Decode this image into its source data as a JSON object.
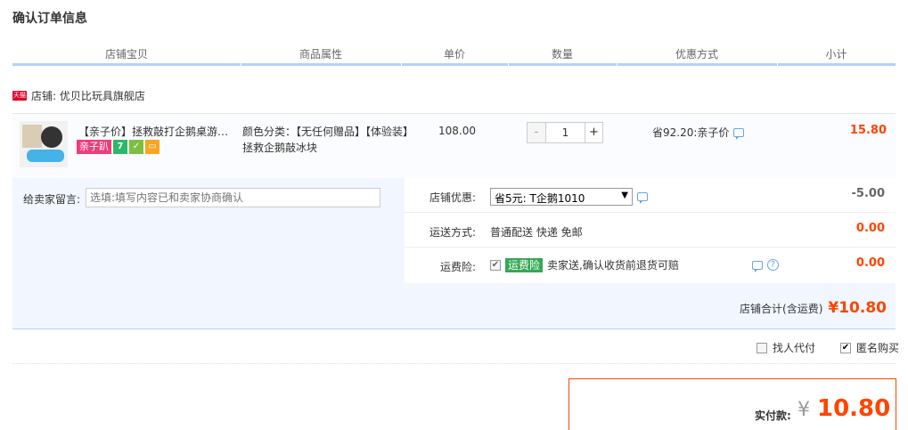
{
  "page_title": "确认订单信息",
  "columns": [
    "店铺宝贝",
    "商品属性",
    "单价",
    "数量",
    "优惠方式",
    "小计"
  ],
  "shop": {
    "badge": "天猫",
    "label": "店铺: 优贝比玩具旗舰店"
  },
  "item": {
    "title": "【亲子价】拯救敲打企鹅桌游冰块破冰游戏",
    "tags": {
      "qinzi": "亲子趴",
      "seven": "7"
    },
    "attr": "颜色分类：【无任何赠品】【体验装】拯救企鹅敲冰块",
    "unit_price": "108.00",
    "quantity": "1",
    "minus": "-",
    "plus": "+",
    "discount": "省92.20:亲子价",
    "subtotal": "15.80"
  },
  "detail": {
    "memo_label": "给卖家留言:",
    "memo_placeholder": "选填:填写内容已和卖家协商确认",
    "shop_discount_label": "店铺优惠:",
    "shop_discount_select": "省5元: T企鹅1010",
    "shop_discount_value": "-5.00",
    "shipping_label": "运送方式:",
    "shipping_method": "普通配送 快递 免邮",
    "shipping_value": "0.00",
    "insurance_label": "运费险:",
    "insurance_badge": "运费险",
    "insurance_text": "卖家送,确认收货前退货可赔",
    "insurance_value": "0.00",
    "shop_total_label": "店铺合计(含运费)",
    "shop_total_value": "¥10.80"
  },
  "options": {
    "find_payer": "找人代付",
    "anonymous": "匿名购买"
  },
  "payment": {
    "label": "实付款:",
    "currency": "¥",
    "amount": "10.80"
  },
  "colors": {
    "accent_red": "#ff4400",
    "header_rule": "#b2d1ff",
    "panel_bg": "#f2f7ff"
  }
}
